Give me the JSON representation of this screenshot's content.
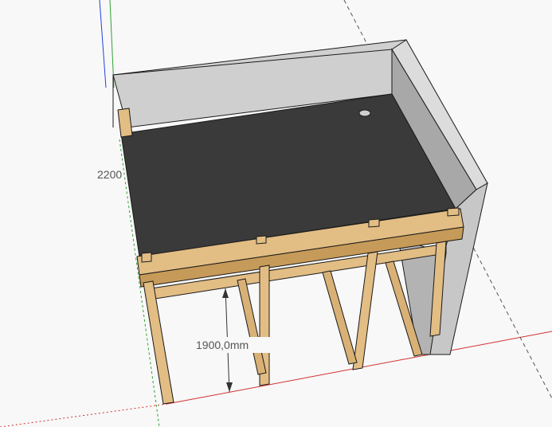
{
  "app": {
    "background_color": "#f8f8f8"
  },
  "dimensions": {
    "height_label": "2200",
    "clearance_label": "1900,0mm"
  },
  "colors": {
    "axis_red": "#d23030",
    "axis_green": "#30a030",
    "axis_blue": "#2040e0",
    "concrete_light": "#d8d8d8",
    "concrete_mid": "#c4c4c4",
    "concrete_dark": "#a6a6a6",
    "slab_top": "#3a3a3a",
    "timber": "#e2bd84",
    "timber_shade": "#c69a58",
    "edge": "#1a1a1a"
  },
  "icons": {
    "drain": "drain-hole-icon",
    "axes": "model-axes-icon"
  }
}
